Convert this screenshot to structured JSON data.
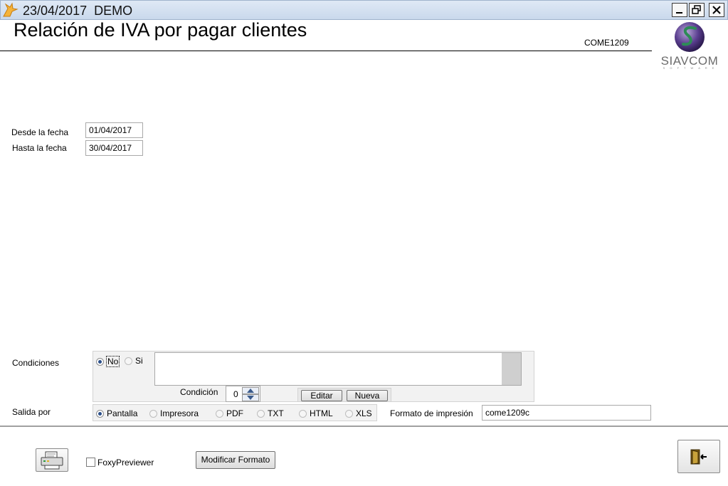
{
  "window": {
    "title": "23/04/2017  DEMO"
  },
  "header": {
    "title": "Relación de IVA por pagar clientes",
    "code": "COME1209",
    "logo_text": "SIAVCOM",
    "logo_subtext": "S O F T W A R E"
  },
  "dates": {
    "from_label": "Desde la fecha",
    "from_value": "01/04/2017",
    "to_label": "Hasta la fecha",
    "to_value": "30/04/2017"
  },
  "conditions": {
    "label": "Condiciones",
    "option_no": "No",
    "option_si": "Si",
    "selected": "No",
    "condition_label": "Condición",
    "condition_value": "0",
    "edit_button": "Editar",
    "new_button": "Nueva"
  },
  "output": {
    "label": "Salida por",
    "options": [
      "Pantalla",
      "Impresora",
      "PDF",
      "TXT",
      "HTML",
      "XLS"
    ],
    "selected": "Pantalla",
    "format_label": "Formato de impresión",
    "format_value": "come1209c"
  },
  "footer": {
    "foxy_label": "FoxyPreviewer",
    "modify_button": "Modificar Formato"
  }
}
